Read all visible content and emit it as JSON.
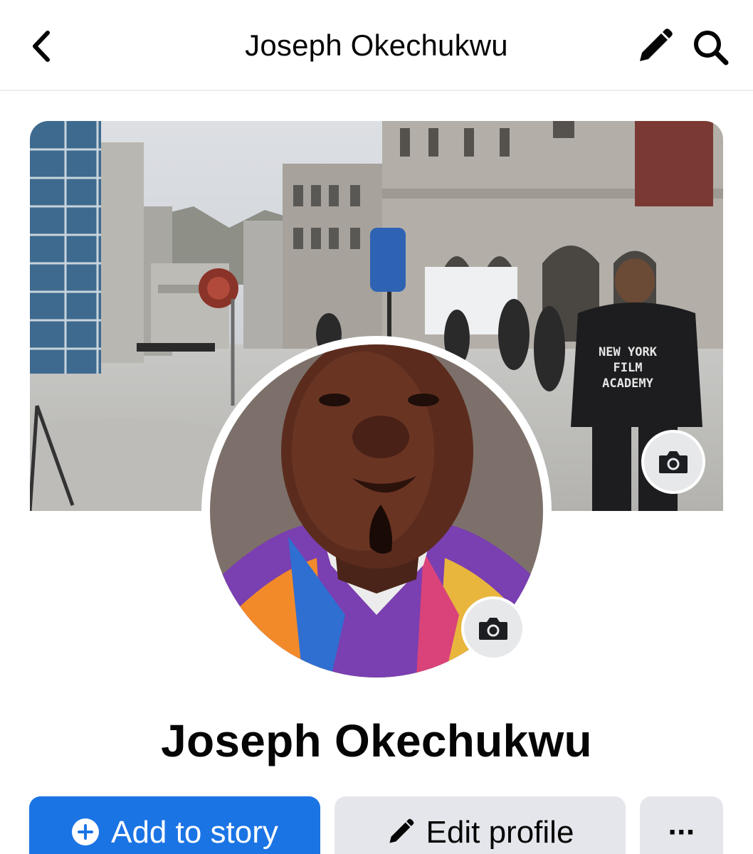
{
  "header": {
    "title": "Joseph Okechukwu",
    "back_icon": "chevron-left-icon",
    "edit_icon": "pencil-icon",
    "search_icon": "search-icon"
  },
  "cover": {
    "jacket_text": [
      "NEW YORK",
      "FILM",
      "ACADEMY"
    ],
    "camera_icon": "camera-icon"
  },
  "profile": {
    "name": "Joseph Okechukwu",
    "camera_icon": "camera-icon"
  },
  "actions": {
    "add_story_label": "Add to story",
    "edit_profile_label": "Edit profile",
    "more_label": "···"
  },
  "colors": {
    "primary_blue": "#1b74e4",
    "secondary_button": "#e4e6eb",
    "text": "#050505"
  }
}
